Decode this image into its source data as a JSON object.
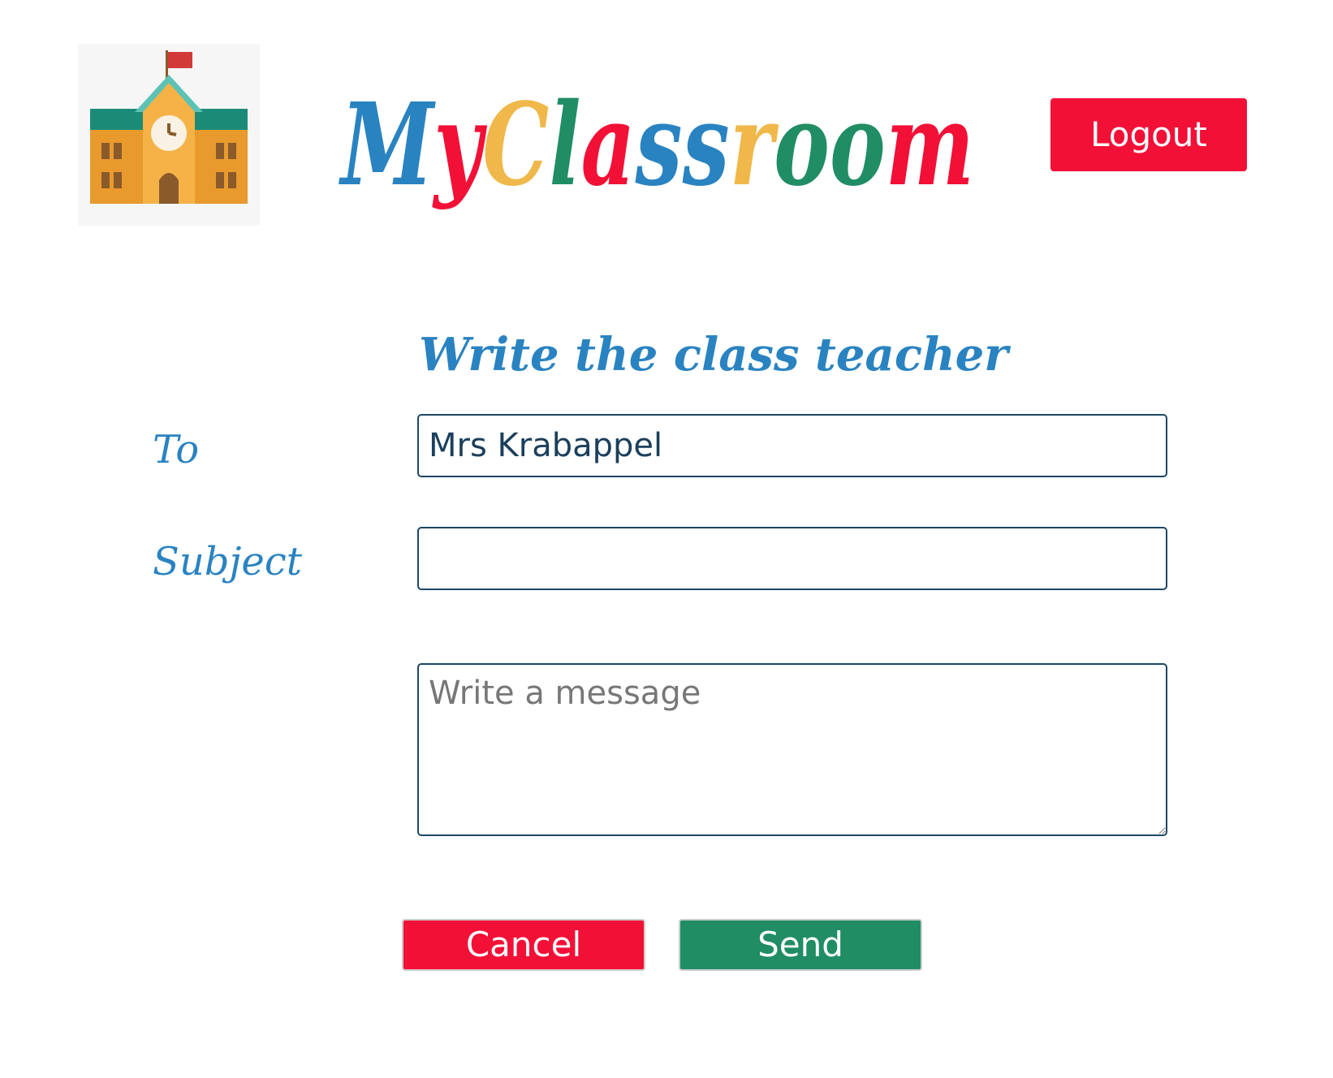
{
  "header": {
    "brand_letters": [
      {
        "char": "M",
        "color": "#2a83c1"
      },
      {
        "char": "y",
        "color": "#f21037"
      },
      {
        "char": "C",
        "color": "#f0b84a"
      },
      {
        "char": "l",
        "color": "#208d64"
      },
      {
        "char": "a",
        "color": "#f21037"
      },
      {
        "char": "s",
        "color": "#2a83c1"
      },
      {
        "char": "s",
        "color": "#2a83c1"
      },
      {
        "char": "r",
        "color": "#f0b84a"
      },
      {
        "char": "o",
        "color": "#208d64"
      },
      {
        "char": "o",
        "color": "#208d64"
      },
      {
        "char": "m",
        "color": "#f21037"
      }
    ],
    "logo_icon": "school-building-icon",
    "logout_label": "Logout"
  },
  "form": {
    "heading": "Write the class teacher",
    "to_label": "To",
    "to_value": "Mrs Krabappel",
    "subject_label": "Subject",
    "subject_value": "",
    "message_placeholder": "Write a message",
    "message_value": ""
  },
  "actions": {
    "cancel_label": "Cancel",
    "send_label": "Send"
  },
  "colors": {
    "blue": "#2a83c1",
    "red": "#f21037",
    "green": "#208d64",
    "yellow": "#f0b84a",
    "field_border": "#1c4766"
  }
}
